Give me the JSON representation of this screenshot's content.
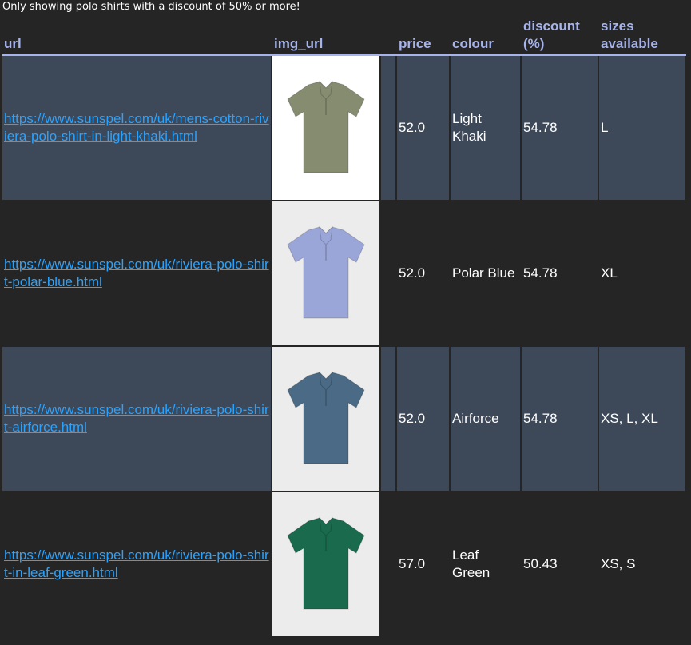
{
  "caption": "Only showing polo shirts with a discount of 50% or more!",
  "columns": {
    "url": "url",
    "img_url": "img_url",
    "price": "price",
    "colour": "colour",
    "discount": "discount (%)",
    "sizes": "sizes available"
  },
  "rows": [
    {
      "url": "https://www.sunspel.com/uk/mens-cotton-riviera-polo-shirt-in-light-khaki.html",
      "price": "52.0",
      "colour": "Light Khaki",
      "discount": "54.78",
      "sizes": "L",
      "shirt_color": "#858c70",
      "image_bg": "#ffffff"
    },
    {
      "url": "https://www.sunspel.com/uk/riviera-polo-shirt-polar-blue.html",
      "price": "52.0",
      "colour": "Polar Blue",
      "discount": "54.78",
      "sizes": "XL",
      "shirt_color": "#9aa6d8",
      "image_bg": "#ececec"
    },
    {
      "url": "https://www.sunspel.com/uk/riviera-polo-shirt-airforce.html",
      "price": "52.0",
      "colour": "Airforce",
      "discount": "54.78",
      "sizes": "XS, L, XL",
      "shirt_color": "#4a6a85",
      "image_bg": "#ececec"
    },
    {
      "url": "https://www.sunspel.com/uk/riviera-polo-shirt-in-leaf-green.html",
      "price": "57.0",
      "colour": "Leaf Green",
      "discount": "50.43",
      "sizes": "XS, S",
      "shirt_color": "#1a6a4e",
      "image_bg": "#ececec"
    }
  ],
  "colors": {
    "header_text": "#a7b4ec",
    "link": "#2aa3ff",
    "row_shade": "#3d4859",
    "background": "#252525"
  }
}
